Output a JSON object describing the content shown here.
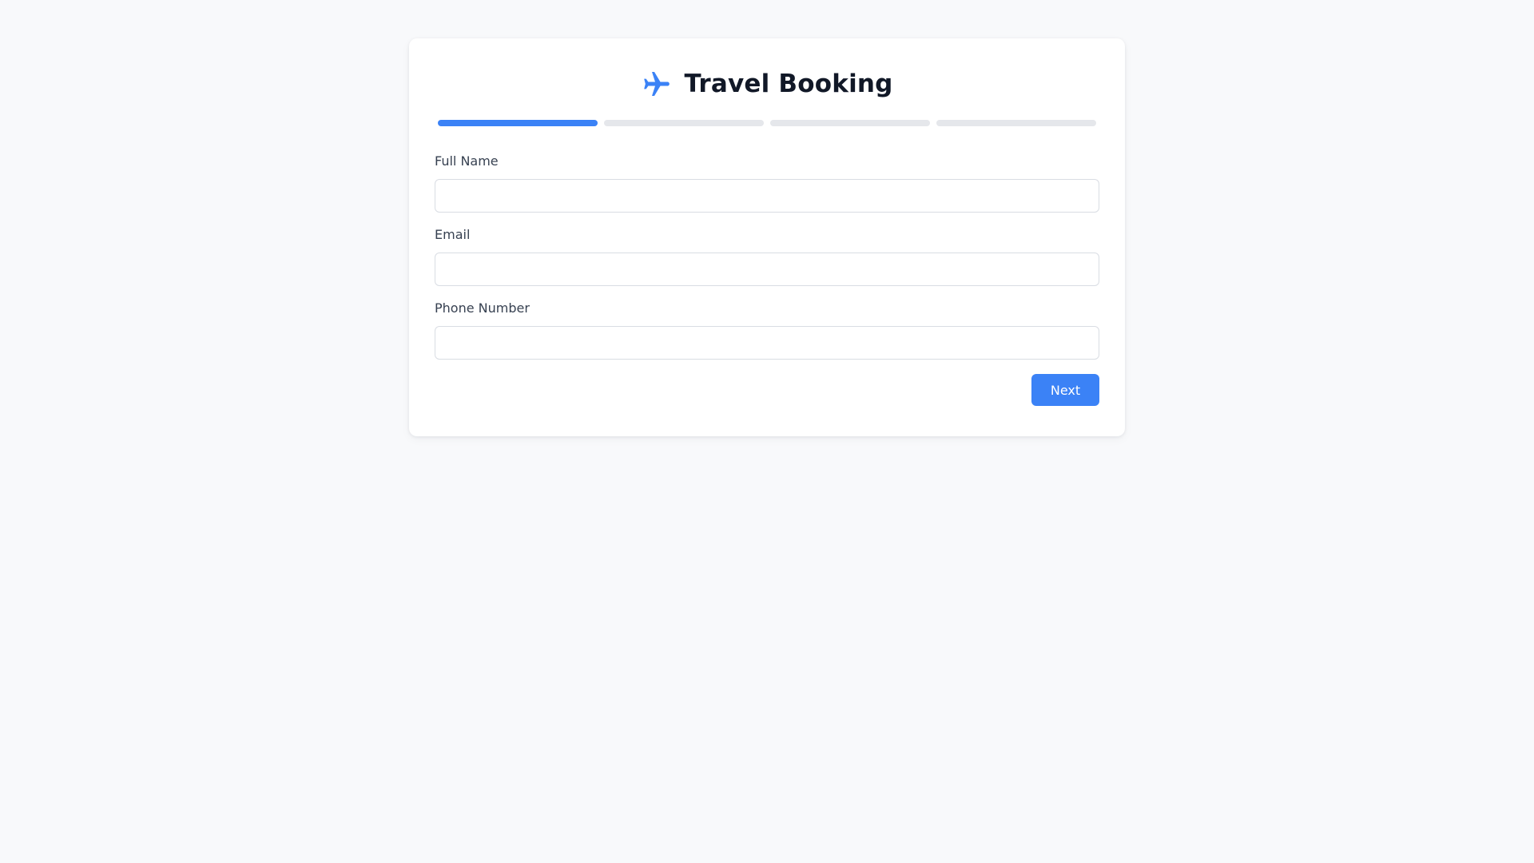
{
  "header": {
    "icon": "airplane-icon",
    "title": "Travel Booking",
    "accent_color": "#3b82f6"
  },
  "progress": {
    "total_steps": 4,
    "current_step": 1,
    "active_color": "#3b82f6",
    "inactive_color": "#e5e7eb"
  },
  "form": {
    "fields": [
      {
        "label": "Full Name",
        "value": "",
        "placeholder": ""
      },
      {
        "label": "Email",
        "value": "",
        "placeholder": ""
      },
      {
        "label": "Phone Number",
        "value": "",
        "placeholder": ""
      }
    ]
  },
  "actions": {
    "next_label": "Next",
    "next_color": "#3b82f6"
  }
}
